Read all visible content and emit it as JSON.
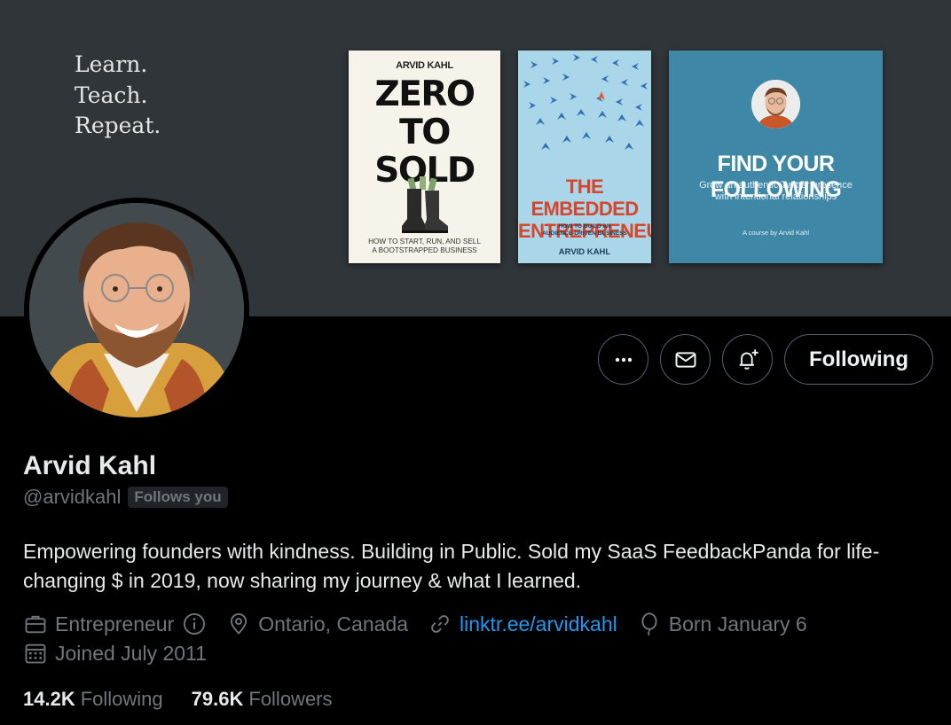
{
  "banner": {
    "tagline": [
      "Learn.",
      "Teach.",
      "Repeat."
    ],
    "book1": {
      "author": "ARVID KAHL",
      "title": [
        "ZERO",
        "TO",
        "SOLD"
      ],
      "subtitle": [
        "HOW TO START, RUN, AND SELL",
        "A BOOTSTRAPPED BUSINESS"
      ]
    },
    "book2": {
      "title": [
        "THE EMBEDDED",
        "ENTREPRENEUR"
      ],
      "subtitle": [
        "HOW TO BUILD AN",
        "AUDIENCE-DRIVEN BUSINESS"
      ],
      "author": "ARVID KAHL"
    },
    "book3": {
      "title": "FIND YOUR FOLLOWING",
      "subtitle": [
        "Grow an authentic Twitter presence",
        "with intentional relationships"
      ],
      "credit": "A course by Arvid Kahl"
    }
  },
  "actions": {
    "more_icon": "more-horizontal-icon",
    "message_icon": "envelope-icon",
    "notify_icon": "bell-plus-icon",
    "follow_label": "Following"
  },
  "profile": {
    "name": "Arvid Kahl",
    "handle": "@arvidkahl",
    "follows_badge": "Follows you",
    "bio": "Empowering founders with kindness. Building in Public. Sold my SaaS FeedbackPanda for life-changing $ in 2019, now sharing my journey & what I learned.",
    "meta": {
      "category": "Entrepreneur",
      "location": "Ontario, Canada",
      "link": "linktr.ee/arvidkahl",
      "birthday": "Born January 6",
      "joined": "Joined July 2011"
    },
    "stats": {
      "following_count": "14.2K",
      "following_label": "Following",
      "followers_count": "79.6K",
      "followers_label": "Followers"
    }
  },
  "colors": {
    "background": "#000000",
    "banner": "#2f3538",
    "link": "#1d9bf0",
    "muted_text": "#71767b",
    "primary_text": "#e7e9ea",
    "border": "#536471"
  }
}
